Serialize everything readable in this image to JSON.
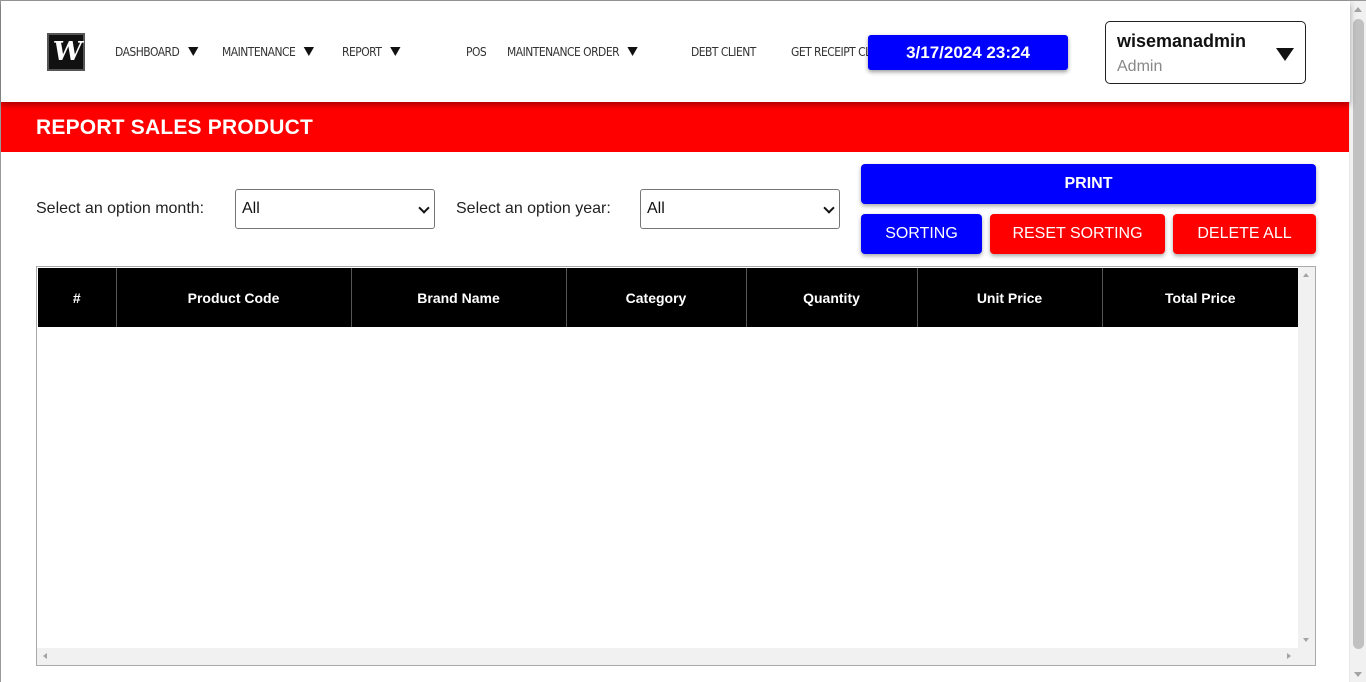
{
  "header": {
    "nav": [
      {
        "label": "DASHBOARD",
        "dropdown": true
      },
      {
        "label": "MAINTENANCE",
        "dropdown": true
      },
      {
        "label": "REPORT",
        "dropdown": true
      },
      {
        "label": "POS",
        "dropdown": false
      },
      {
        "label": "MAINTENANCE ORDER",
        "dropdown": true
      },
      {
        "label": "DEBT CLIENT",
        "dropdown": false
      },
      {
        "label": "GET RECEIPT CLIENT",
        "dropdown": false
      }
    ],
    "datetime": "3/17/2024 23:24",
    "user": {
      "name": "wisemanadmin",
      "role": "Admin"
    }
  },
  "page": {
    "title": "REPORT SALES PRODUCT"
  },
  "filters": {
    "month_label": "Select an option month:",
    "month_value": "All",
    "year_label": "Select an option year:",
    "year_value": "All"
  },
  "buttons": {
    "print": "PRINT",
    "sorting": "SORTING",
    "reset_sorting": "RESET SORTING",
    "delete_all": "DELETE ALL"
  },
  "table": {
    "columns": [
      "#",
      "Product Code",
      "Brand Name",
      "Category",
      "Quantity",
      "Unit Price",
      "Total Price"
    ],
    "rows": []
  },
  "colors": {
    "accent_blue": "#0000ff",
    "accent_red": "#ff0000",
    "table_header": "#000000"
  }
}
